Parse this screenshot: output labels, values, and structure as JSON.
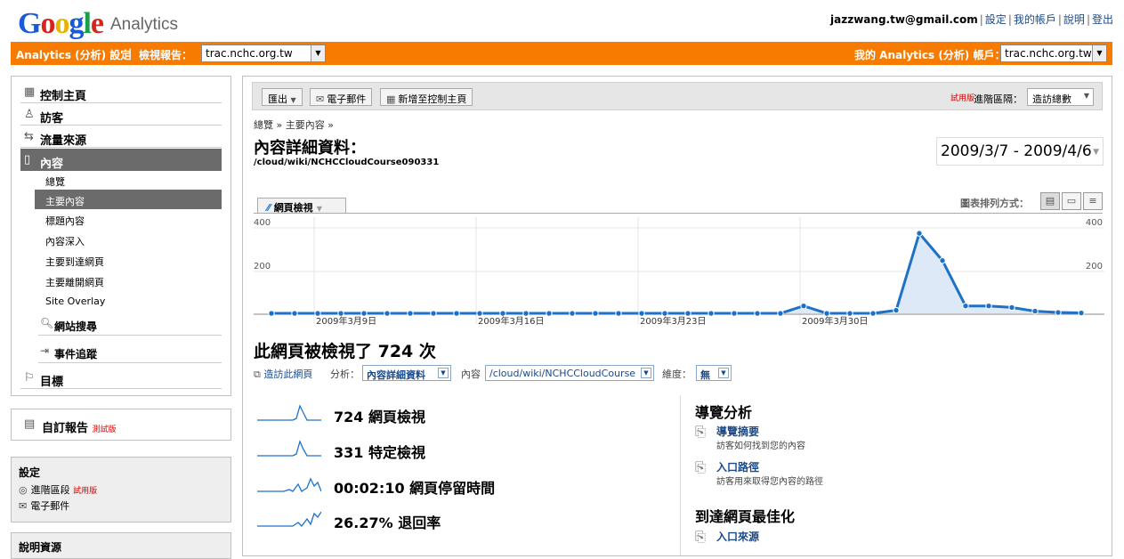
{
  "header": {
    "logo_google": "Google",
    "logo_product": "Analytics",
    "email": "jazzwang.tw@gmail.com",
    "links": [
      "設定",
      "我的帳戶",
      "說明",
      "登出"
    ]
  },
  "orange_bar": {
    "settings_label": "Analytics (分析) 設定",
    "view_reports_label": "檢視報告：",
    "site_value": "trac.nchc.org.tw",
    "my_account_label": "我的 Analytics (分析) 帳戶：",
    "account_value": "trac.nchc.org.tw"
  },
  "nav": {
    "dashboard": "控制主頁",
    "visitors": "訪客",
    "traffic_sources": "流量來源",
    "content": "內容",
    "content_items": [
      "總覽",
      "主要內容",
      "標題內容",
      "內容深入",
      "主要到達網頁",
      "主要離開網頁",
      "Site Overlay"
    ],
    "site_search": "網站搜尋",
    "event_tracking": "事件追蹤",
    "goals": "目標"
  },
  "custom_reports": {
    "label": "自訂報告",
    "beta": "測試版"
  },
  "settings": {
    "title": "設定",
    "advanced_segments": "進階區段",
    "beta": "試用版",
    "email": "電子郵件"
  },
  "more": {
    "title": "說明資源"
  },
  "toolbar": {
    "export": "匯出",
    "email": "電子郵件",
    "add_dashboard": "新增至控制主頁",
    "beta": "試用版",
    "segment_label": "進階區隔：",
    "segment_value": "造訪總數"
  },
  "page": {
    "breadcrumb": "總覽 » 主要內容 »",
    "title": "內容詳細資料：",
    "url": "/cloud/wiki/NCHCCloudCourse090331",
    "date_range": "2009/3/7 - 2009/4/6"
  },
  "graph": {
    "tab": "網頁檢視",
    "graph_by_label": "圖表排列方式："
  },
  "chart_data": {
    "type": "area",
    "series": [
      {
        "name": "網頁檢視",
        "values": [
          8,
          8,
          8,
          8,
          8,
          8,
          8,
          8,
          8,
          8,
          8,
          8,
          8,
          8,
          8,
          8,
          8,
          8,
          8,
          8,
          8,
          8,
          8,
          42,
          8,
          8,
          8,
          22,
          375,
          250,
          42,
          42,
          35,
          18,
          12,
          10
        ]
      }
    ],
    "x_ticks": [
      "2009年3月9日",
      "2009年3月16日",
      "2009年3月23日",
      "2009年3月30日"
    ],
    "y_ticks": [
      200,
      400
    ],
    "ylim": [
      0,
      400
    ],
    "color": "#1d72c8",
    "fill": "#dde9f6",
    "grid": true
  },
  "summary": {
    "views_title": "此網頁被檢視了 724 次",
    "visit_page": "造訪此網頁",
    "analysis_label": "分析：",
    "analysis_value": "內容詳細資料",
    "content_label": "內容",
    "content_value": "/cloud/wiki/NCHCCloudCourse",
    "dimension_label": "維度：",
    "dimension_value": "無"
  },
  "metrics": [
    {
      "text": "724 網頁檢視"
    },
    {
      "text": "331 特定檢視"
    },
    {
      "text": "00:02:10 網頁停留時間"
    },
    {
      "text": "26.27% 退回率"
    }
  ],
  "right_panel": {
    "nav_analysis": "導覽分析",
    "nav_summary": "導覽摘要",
    "nav_summary_desc": "訪客如何找到您的內容",
    "entrance_paths": "入口路徑",
    "entrance_paths_desc": "訪客用來取得您內容的路徑",
    "landing_opt": "到達網頁最佳化",
    "entrance_sources": "入口來源"
  }
}
